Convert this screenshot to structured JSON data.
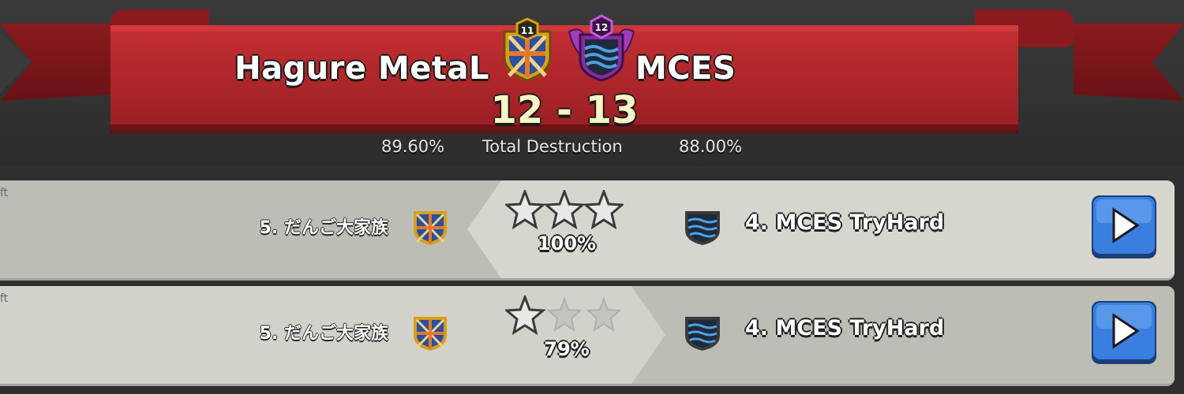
{
  "war": {
    "left_clan": {
      "name": "Hagure MetaL",
      "level": "11",
      "destruction": "89.60%"
    },
    "right_clan": {
      "name": "MCES",
      "level": "12",
      "destruction": "88.00%"
    },
    "score": "12 - 13",
    "destruction_label": "Total Destruction"
  },
  "attacks": [
    {
      "tag": "ft",
      "attacker": "5. だんご大家族",
      "defender": "4. MCES TryHard",
      "stars_earned": 3,
      "stars_total": 3,
      "destruction": "100%"
    },
    {
      "tag": "ft",
      "attacker": "5. だんご大家族",
      "defender": "4. MCES TryHard",
      "stars_earned": 1,
      "stars_total": 3,
      "destruction": "79%"
    }
  ],
  "colors": {
    "ribbon": "#b3262a",
    "score_text": "#fbf4c6",
    "play_button": "#3a7fe0",
    "star_earned": "#e6e6e6",
    "star_empty": "#bcbcb6"
  }
}
